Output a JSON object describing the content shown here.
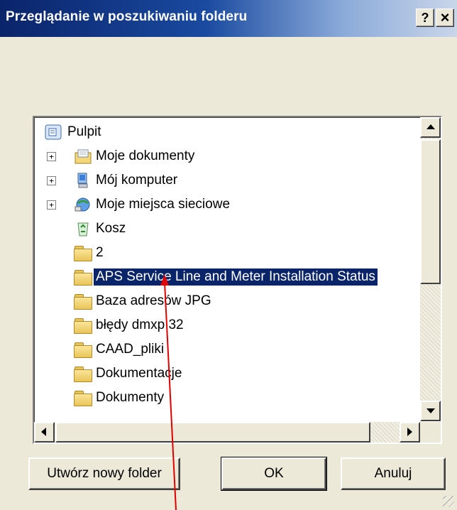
{
  "dialog": {
    "title": "Przeglądanie w poszukiwaniu folderu",
    "help_label": "?",
    "close_label": "×"
  },
  "tree": {
    "items": [
      {
        "label": "Pulpit",
        "icon": "desktop-icon",
        "expander": "",
        "selected": false
      },
      {
        "label": "Moje dokumenty",
        "icon": "my-documents-icon",
        "expander": "+",
        "selected": false
      },
      {
        "label": "Mój komputer",
        "icon": "my-computer-icon",
        "expander": "+",
        "selected": false
      },
      {
        "label": "Moje miejsca sieciowe",
        "icon": "network-places-icon",
        "expander": "+",
        "selected": false
      },
      {
        "label": "Kosz",
        "icon": "recycle-bin-icon",
        "expander": "",
        "selected": false
      },
      {
        "label": "2",
        "icon": "folder-icon",
        "expander": "",
        "selected": false
      },
      {
        "label": "APS  Service Line and Meter Installation Status",
        "icon": "folder-icon",
        "expander": "",
        "selected": true
      },
      {
        "label": "Baza adresów JPG",
        "icon": "folder-icon",
        "expander": "",
        "selected": false
      },
      {
        "label": "błędy dmxp 32",
        "icon": "folder-icon",
        "expander": "",
        "selected": false
      },
      {
        "label": "CAAD_pliki",
        "icon": "folder-icon",
        "expander": "",
        "selected": false
      },
      {
        "label": "Dokumentacje",
        "icon": "folder-icon",
        "expander": "",
        "selected": false
      },
      {
        "label": "Dokumenty",
        "icon": "folder-icon",
        "expander": "",
        "selected": false
      }
    ]
  },
  "buttons": {
    "new_folder": "Utwórz nowy folder",
    "ok": "OK",
    "cancel": "Anuluj"
  },
  "colors": {
    "selection": "#0a246a",
    "titlebar": "#0a246a",
    "annotation_arrow": "#e00000"
  }
}
